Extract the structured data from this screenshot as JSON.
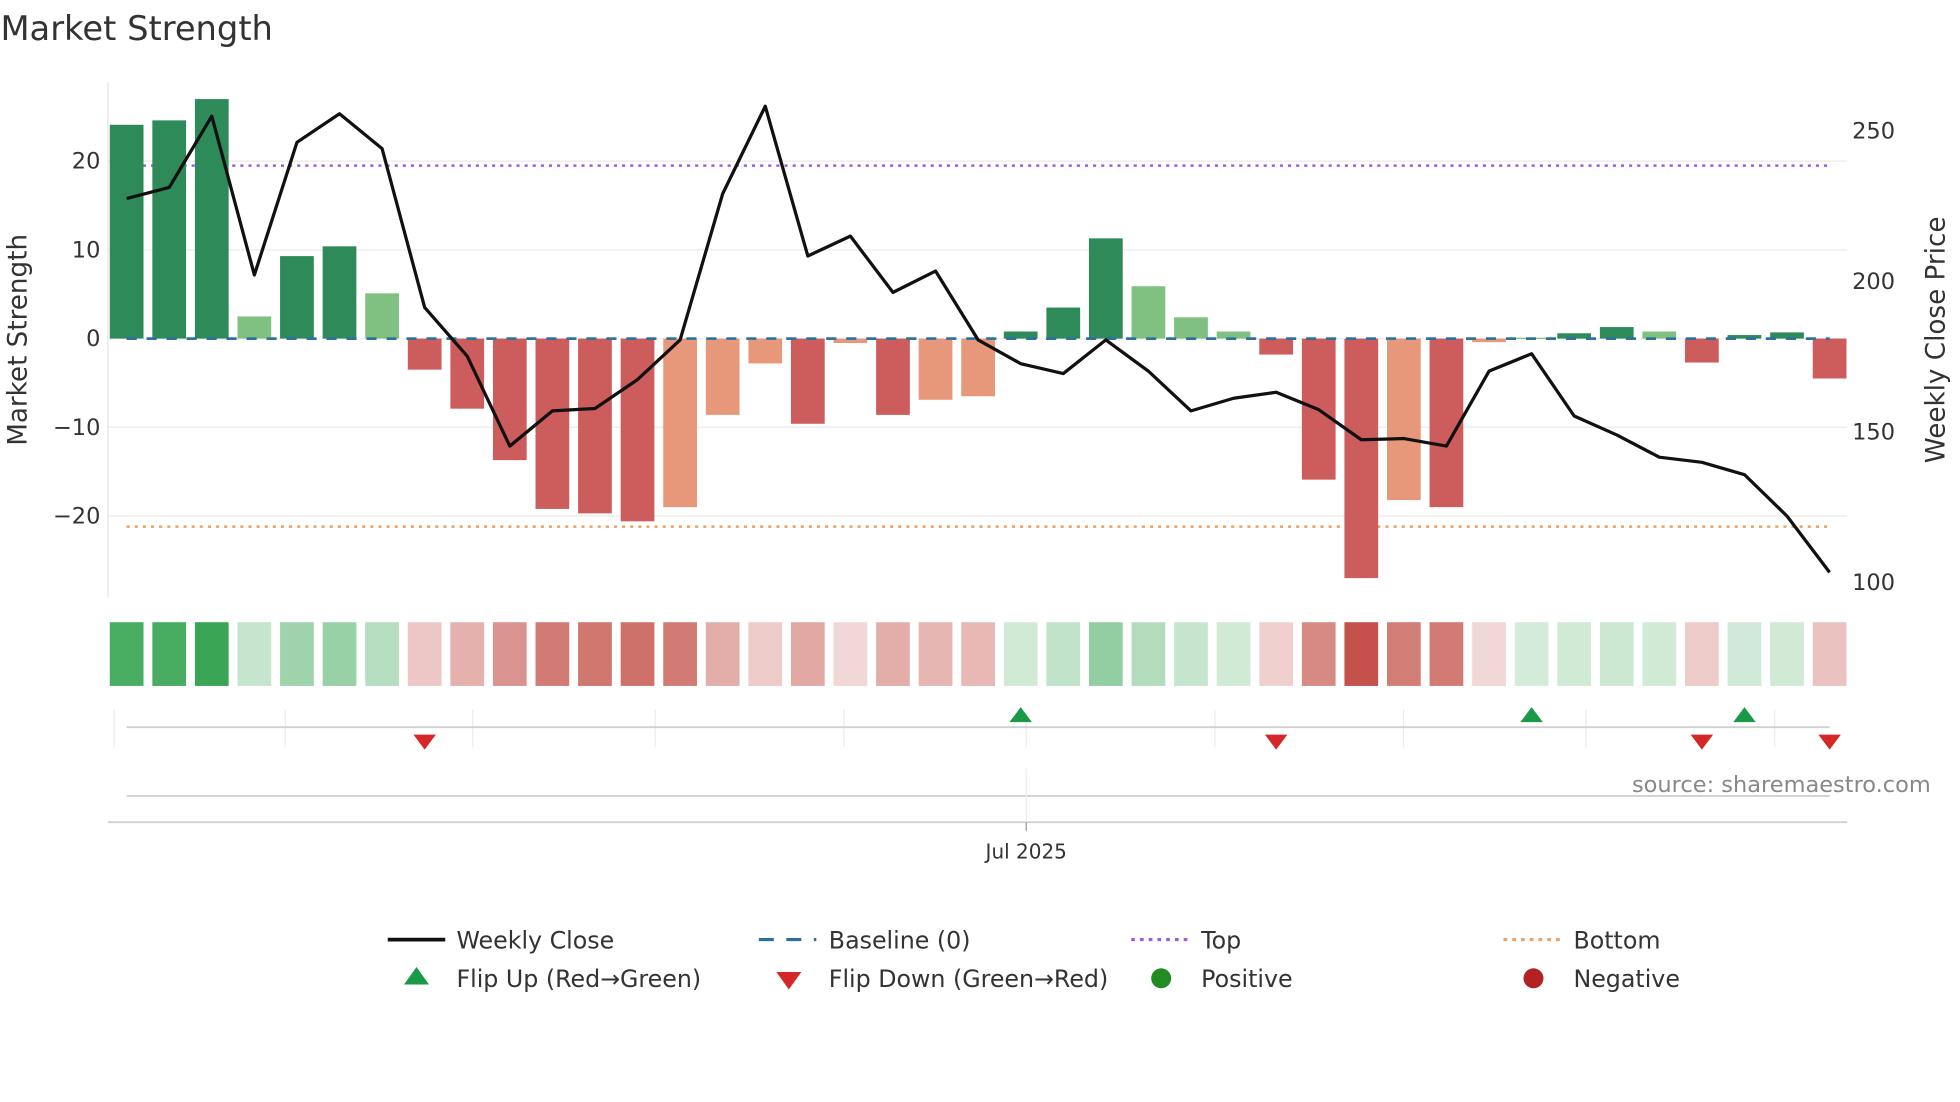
{
  "chart_data": {
    "type": "bar",
    "title": "Market Strength",
    "ylabel": "Market Strength",
    "y2label": "Weekly Close Price",
    "ylim": [
      -29,
      29
    ],
    "y2lim": [
      96,
      276
    ],
    "yticks": [
      20,
      10,
      0,
      -10,
      -20
    ],
    "ytick_labels": [
      "20",
      "10",
      "0",
      "−10",
      "−20"
    ],
    "y2ticks": [
      250,
      200,
      150,
      100
    ],
    "y2tick_labels": [
      "250",
      "200",
      "150",
      "100"
    ],
    "xtick_label": "Jul 2025",
    "xtick_index": 21,
    "top_line": 19.5,
    "bottom_line": -21.2,
    "grid": true,
    "strength": [
      24.1,
      24.6,
      27.0,
      2.5,
      9.3,
      10.4,
      5.1,
      -3.5,
      -7.9,
      -13.7,
      -19.2,
      -19.7,
      -20.6,
      -19.0,
      -8.6,
      -2.8,
      -9.6,
      -0.5,
      -8.6,
      -6.9,
      -6.5,
      0.8,
      3.5,
      11.3,
      5.9,
      2.4,
      0.8,
      -1.8,
      -15.9,
      -27.0,
      -18.2,
      -19.0,
      -0.4,
      0.1,
      0.6,
      1.3,
      0.8,
      -2.7,
      0.4,
      0.7,
      -4.5
    ],
    "strength_shade": [
      "strong",
      "strong",
      "strong",
      "weak",
      "strong",
      "strong",
      "weak",
      "strong",
      "strong",
      "strong",
      "strong",
      "strong",
      "strong",
      "weak",
      "weak",
      "weak",
      "strong",
      "weak",
      "strong",
      "weak",
      "weak",
      "strong",
      "strong",
      "strong",
      "weak",
      "weak",
      "weak",
      "strong",
      "strong",
      "strong",
      "weak",
      "strong",
      "weak",
      "weak",
      "strong",
      "strong",
      "weak",
      "strong",
      "strong",
      "strong",
      "strong"
    ],
    "weekly_close": [
      227.6,
      231.3,
      255.0,
      202.2,
      246.3,
      255.8,
      244.2,
      191.4,
      175.2,
      145.3,
      157.0,
      157.8,
      167.4,
      180.6,
      229.2,
      258.3,
      208.5,
      215.1,
      196.4,
      203.5,
      180.6,
      172.7,
      169.4,
      180.6,
      170.2,
      157.0,
      161.2,
      163.2,
      157.4,
      147.4,
      147.8,
      145.3,
      170.2,
      176.0,
      155.3,
      149.0,
      141.6,
      139.9,
      135.8,
      122.0,
      103.3
    ],
    "flip_up_indices": [
      21,
      33,
      38
    ],
    "flip_down_indices": [
      7,
      27,
      37,
      40
    ],
    "legend_placement": "bottom-center"
  },
  "colors": {
    "strong_pos": "#2e8a58",
    "weak_pos": "#80c080",
    "strong_neg": "#cd5c5c",
    "weak_neg": "#e8987a",
    "heat_pos": "#3aa655",
    "heat_neg": "#c4524a",
    "line": "#111111",
    "baseline": "#2a6f9e",
    "top": "#9b5fe0",
    "bottom": "#f0a060",
    "flip_up": "#1a9a48",
    "flip_down": "#d62728",
    "positive": "#228b22",
    "negative": "#b22222"
  },
  "legend": {
    "weekly_close": "Weekly Close",
    "baseline": "Baseline (0)",
    "top": "Top",
    "bottom": "Bottom",
    "flip_up": "Flip Up (Red→Green)",
    "flip_down": "Flip Down (Green→Red)",
    "positive": "Positive",
    "negative": "Negative"
  },
  "source": "source: sharemaestro.com"
}
